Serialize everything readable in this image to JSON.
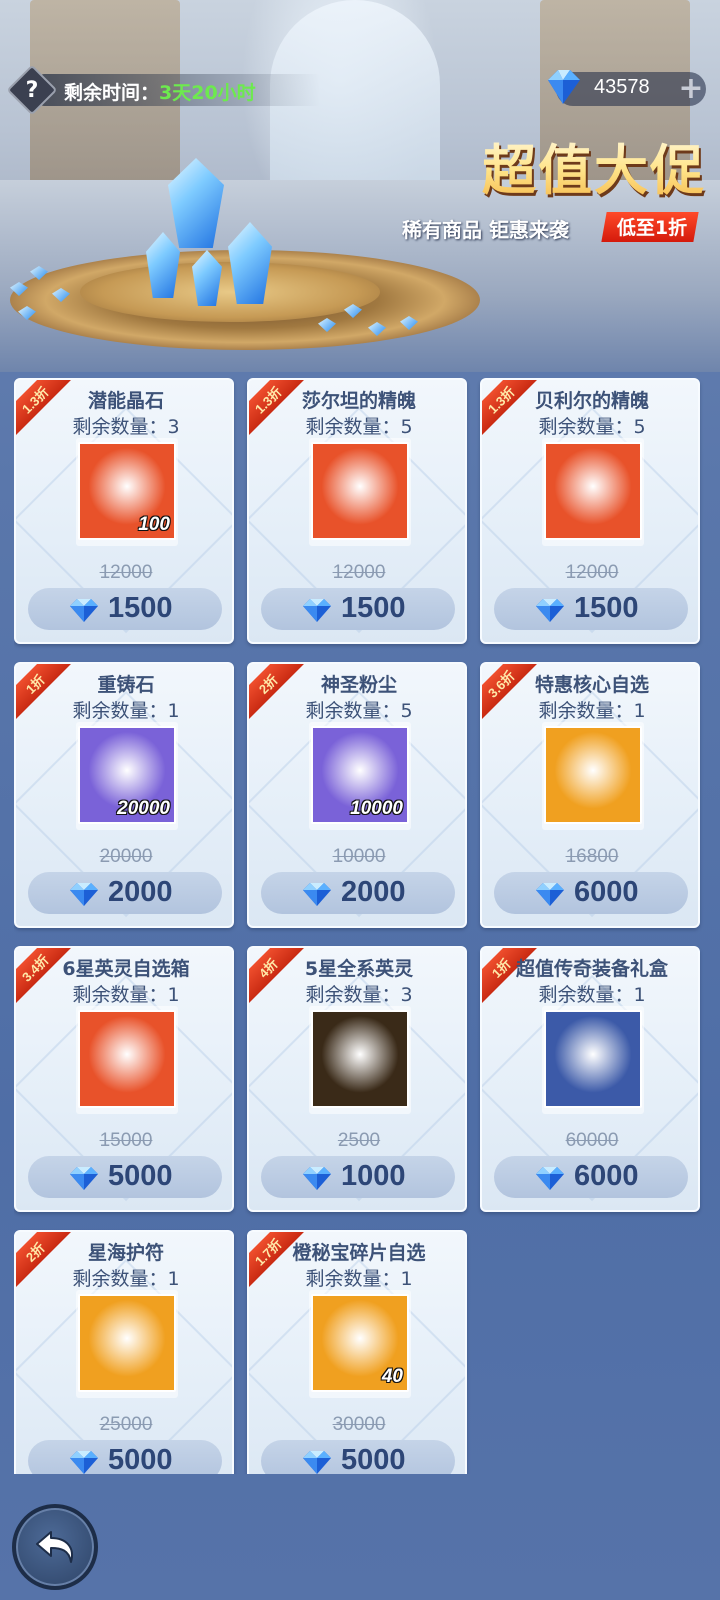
{
  "header": {
    "timer_label": "剩余时间：",
    "timer_value": "3天20小时",
    "currency_amount": "43578",
    "help_icon": "question-mark-icon",
    "plus_icon": "plus-icon"
  },
  "banner": {
    "title": "超值大促",
    "subtitle": "稀有商品 钜惠来袭",
    "badge": "低至1折"
  },
  "items": [
    {
      "name": "潜能晶石",
      "stock": "剩余数量：3",
      "tag": "1.3折",
      "qty": "100",
      "orig_price": "12000",
      "price": "1500",
      "icon": "potential-crystal-icon",
      "bg": "#e8522a"
    },
    {
      "name": "莎尔坦的精魄",
      "stock": "剩余数量：5",
      "tag": "1.3折",
      "qty": "",
      "orig_price": "12000",
      "price": "1500",
      "icon": "dark-orb-icon",
      "bg": "#e8522a"
    },
    {
      "name": "贝利尔的精魄",
      "stock": "剩余数量：5",
      "tag": "1.3折",
      "qty": "",
      "orig_price": "12000",
      "price": "1500",
      "icon": "red-orb-icon",
      "bg": "#e8522a"
    },
    {
      "name": "重铸石",
      "stock": "剩余数量：1",
      "tag": "1折",
      "qty": "20000",
      "orig_price": "20000",
      "price": "2000",
      "icon": "reforge-stone-icon",
      "bg": "#7a62d8"
    },
    {
      "name": "神圣粉尘",
      "stock": "剩余数量：5",
      "tag": "2折",
      "qty": "10000",
      "orig_price": "10000",
      "price": "2000",
      "icon": "holy-dust-icon",
      "bg": "#7a62d8"
    },
    {
      "name": "特惠核心自选",
      "stock": "剩余数量：1",
      "tag": "3.6折",
      "qty": "",
      "orig_price": "16800",
      "price": "6000",
      "icon": "core-card-icon",
      "bg": "#f0a020"
    },
    {
      "name": "6星英灵自选箱",
      "stock": "剩余数量：1",
      "tag": "3.4折",
      "qty": "",
      "orig_price": "15000",
      "price": "5000",
      "icon": "hero-helmet-icon",
      "bg": "#e8522a"
    },
    {
      "name": "5星全系英灵",
      "stock": "剩余数量：3",
      "tag": "4折",
      "qty": "",
      "orig_price": "2500",
      "price": "1000",
      "icon": "golden-hero-icon",
      "bg": "#3a2a18"
    },
    {
      "name": "超值传奇装备礼盒",
      "stock": "剩余数量：1",
      "tag": "1折",
      "qty": "",
      "orig_price": "60000",
      "price": "6000",
      "icon": "legendary-armor-icon",
      "bg": "#3c5aa8"
    },
    {
      "name": "星海护符",
      "stock": "剩余数量：1",
      "tag": "2折",
      "qty": "",
      "orig_price": "25000",
      "price": "5000",
      "icon": "star-amulet-icon",
      "bg": "#f0a020"
    },
    {
      "name": "橙秘宝碎片自选",
      "stock": "剩余数量：1",
      "tag": "1.7折",
      "qty": "40",
      "orig_price": "30000",
      "price": "5000",
      "icon": "treasure-altar-icon",
      "bg": "#f0a020"
    }
  ],
  "footer": {
    "back_icon": "back-arrow-icon"
  }
}
